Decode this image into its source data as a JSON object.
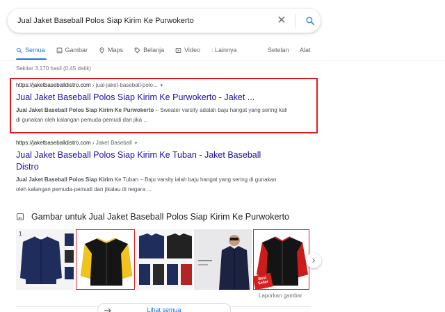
{
  "search": {
    "query": "Jual Jaket Baseball Polos Siap Kirim Ke Purwokerto",
    "clear_glyph": "✕"
  },
  "tabs": [
    {
      "label": "Semua",
      "icon": "search-icon",
      "active": true
    },
    {
      "label": "Gambar",
      "icon": "image-icon"
    },
    {
      "label": "Maps",
      "icon": "map-pin-icon"
    },
    {
      "label": "Belanja",
      "icon": "tag-icon"
    },
    {
      "label": "Video",
      "icon": "play-icon"
    },
    {
      "label": ": Lainnya",
      "icon": "more-vert-icon"
    }
  ],
  "tools": {
    "setelan": "Setelan",
    "alat": "Alat"
  },
  "result_stats": "Sekitar 3.170 hasil (0,45 detik)",
  "results": [
    {
      "domain": "https://jaketbaseballdistro.com",
      "breadcrumb": " › jual-jaket-baseball-polo...",
      "more": "▾",
      "title": "Jual Jaket Baseball Polos Siap Kirim Ke Purwokerto - Jaket ...",
      "snippet_bold": "Jual Jaket Baseball Polos Siap Kirim Ke Purwokerto",
      "snippet_rest": " – Sweater varsity adalah baju hangat yang sering kali di gunakan oleh kalangan pemuda-pemudi dan jika ..."
    },
    {
      "domain": "https://jaketbaseballdistro.com",
      "breadcrumb": " › Jaket Baseball",
      "more": "▾",
      "title": "Jual Jaket Baseball Polos Siap Kirim Ke Tuban - Jaket Baseball Distro",
      "snippet_bold": "Jual Jaket Baseball Polos Siap Kirim",
      "snippet_rest": " Ke Tuban – Baju varsity ialah baju hangat yang sering di gunakan oleh kalangan pemuda-pemudi dan jikalau di negara ..."
    }
  ],
  "images_section": {
    "title": "Gambar untuk Jual Jaket Baseball Polos Siap Kirim Ke Purwokerto",
    "report": "Laporkan gambar",
    "see_all": "Lihat semua",
    "thumbnail_labels": [
      "1",
      "Best Seller"
    ]
  },
  "colors": {
    "accent": "#1a73e8",
    "link": "#1a0dab",
    "highlight": "#e0181f"
  }
}
